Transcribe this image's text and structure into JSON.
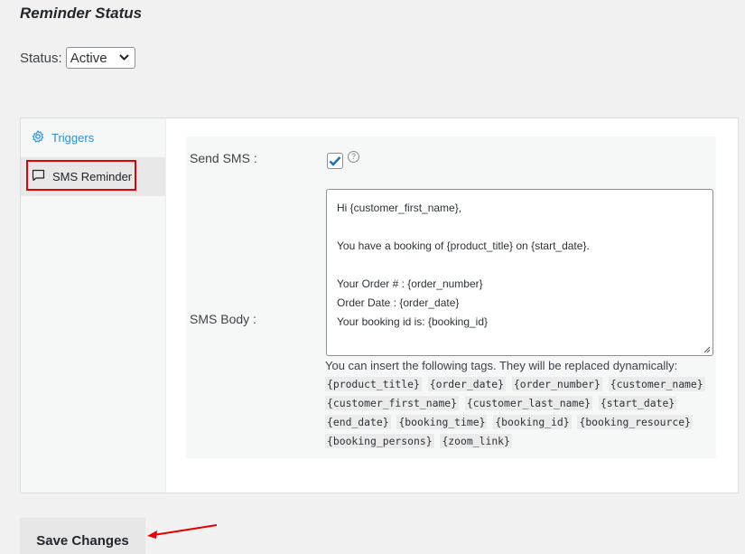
{
  "page": {
    "title": "Reminder Status"
  },
  "status": {
    "label": "Status:",
    "selected": "Active"
  },
  "sidebar": {
    "items": [
      {
        "label": "Triggers",
        "icon": "gear-icon"
      },
      {
        "label": "SMS Reminder",
        "icon": "comment-icon"
      }
    ]
  },
  "form": {
    "send_sms_label": "Send SMS :",
    "send_sms_checked": true,
    "help_glyph": "?",
    "sms_body_label": "SMS Body :",
    "body_lines": [
      "Hi {customer_first_name},",
      "",
      "You have a booking of {product_title} on {start_date}.",
      "",
      "Your Order # : {order_number}",
      "Order Date : {order_date}",
      "Your booking id is: {booking_id}"
    ],
    "tags_hint": "You can insert the following tags. They will be replaced dynamically:",
    "tags": [
      "{product_title}",
      "{order_date}",
      "{order_number}",
      "{customer_name}",
      "{customer_first_name}",
      "{customer_last_name}",
      "{start_date}",
      "{end_date}",
      "{booking_time}",
      "{booking_id}",
      "{booking_resource}",
      "{booking_persons}",
      "{zoom_link}"
    ]
  },
  "actions": {
    "save_label": "Save Changes"
  },
  "colors": {
    "accent_link": "#2e8fd6",
    "highlight": "#e60000",
    "check": "#2271b1"
  }
}
